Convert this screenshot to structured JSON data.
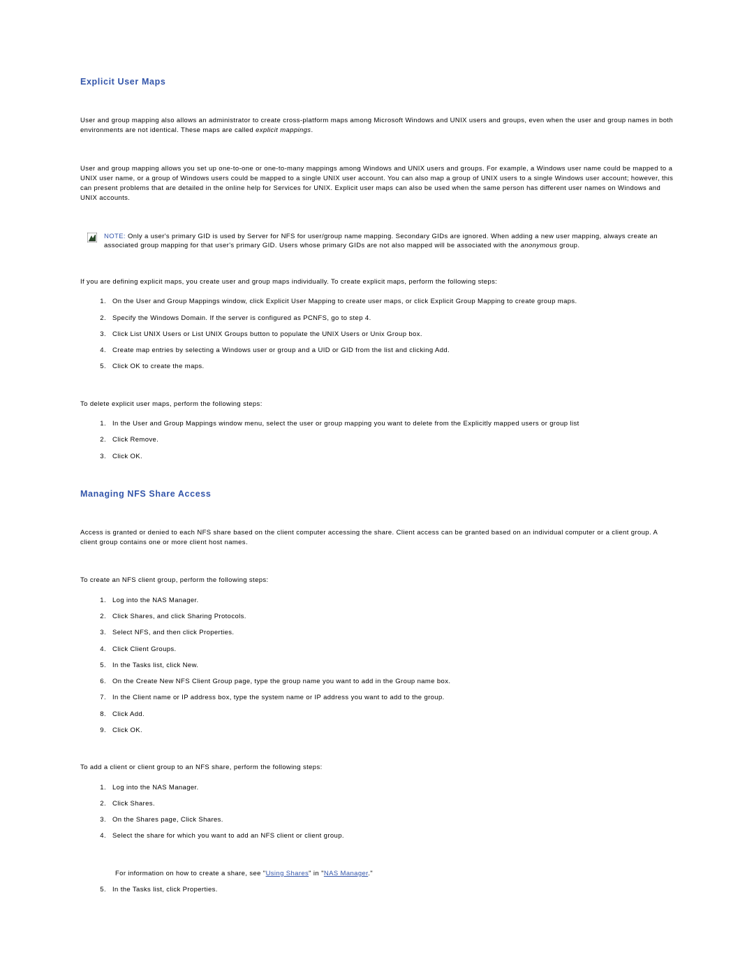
{
  "section1": {
    "title": "Explicit User Maps",
    "para1_a": "User and group mapping also allows an administrator to create cross-platform maps among Microsoft Windows and UNIX users and groups, even when the user and group names in both environments are not identical. These maps are called ",
    "para1_em": "explicit mappings",
    "para1_b": ".",
    "para2": "User and group mapping allows you set up one-to-one or one-to-many mappings among Windows and UNIX users and groups. For example, a Windows user name could be mapped to a UNIX user name, or a group of Windows users could be mapped to a single UNIX user account. You can also map a group of UNIX users to a single Windows user account; however, this can present problems that are detailed in the online help for Services for UNIX. Explicit user maps can also be used when the same person has different user names on Windows and UNIX accounts.",
    "note_label": "NOTE: ",
    "note_a": "Only a user's primary GID is used by Server for NFS for user/group name mapping. Secondary GIDs are ignored. When adding a new user mapping, always create an associated group mapping for that user's primary GID. Users whose primary GIDs are not also mapped will be associated with the ",
    "note_em": "anonymous",
    "note_b": " group.",
    "para3": "If you are defining explicit maps, you create user and group maps individually. To create explicit maps, perform the following steps:",
    "list1": [
      "On the User and Group Mappings window, click Explicit User Mapping to create user maps, or click Explicit Group Mapping to create group maps.",
      "Specify the Windows Domain. If the server is configured as PCNFS, go to step 4.",
      "Click List UNIX Users or List UNIX Groups button to populate the UNIX Users or Unix Group box.",
      "Create map entries by selecting a Windows user or group and a UID or GID from the list and clicking Add.",
      "Click OK to create the maps."
    ],
    "para4": "To delete explicit user maps, perform the following steps:",
    "list2": [
      "In the User and Group Mappings window menu, select the user or group mapping you want to delete from the Explicitly mapped users or group list",
      "Click Remove.",
      "Click OK."
    ]
  },
  "section2": {
    "title": "Managing NFS Share Access",
    "para1": "Access is granted or denied to each NFS share based on the client computer accessing the share. Client access can be granted based on an individual computer or a client group. A client group contains one or more client host names.",
    "para2": "To create an NFS client group, perform the following steps:",
    "list1": [
      "Log into the NAS Manager.",
      "Click Shares, and click Sharing Protocols.",
      "Select NFS, and then click Properties.",
      "Click Client Groups.",
      "In the Tasks list, click New.",
      "On the Create New NFS Client Group page, type the group name you want to add in the Group name box.",
      "In the Client name or IP address box, type the system name or IP address you want to add to the group.",
      "Click Add.",
      "Click OK."
    ],
    "para3": "To add a client or client group to an NFS share, perform the following steps:",
    "list2": {
      "i1": "Log into the NAS Manager.",
      "i2": "Click Shares.",
      "i3": "On the Shares page, Click Shares.",
      "i4": "Select the share for which you want to add an NFS client or client group.",
      "info_a": "For information on how to create a share, see \"",
      "link1": "Using Shares",
      "info_b": "\" in \"",
      "link2": "NAS Manager",
      "info_c": ".\"",
      "i5": "In the Tasks list, click Properties."
    }
  }
}
